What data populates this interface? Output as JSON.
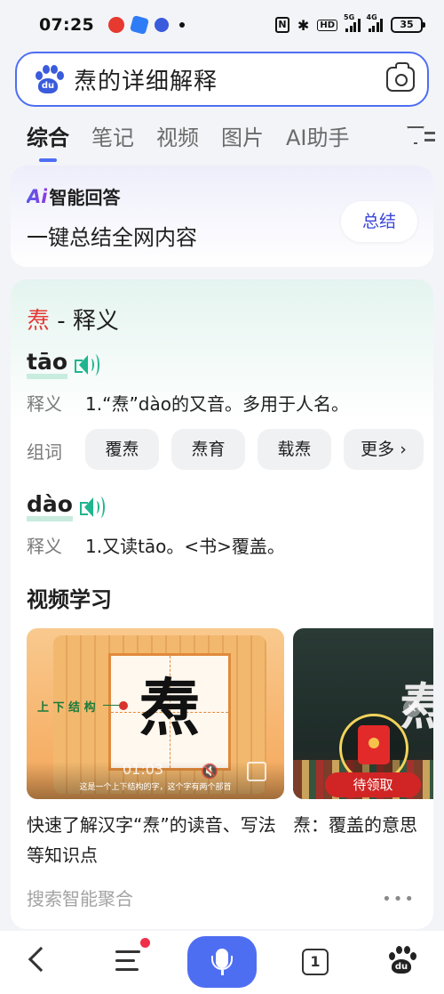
{
  "status_bar": {
    "time": "07:25",
    "hd_label": "HD",
    "signal1_label": "5G",
    "signal2_label": "4G",
    "battery": "35"
  },
  "search": {
    "query": "焘的详细解释"
  },
  "tabs": [
    {
      "label": "综合"
    },
    {
      "label": "笔记"
    },
    {
      "label": "视频"
    },
    {
      "label": "图片"
    },
    {
      "label": "AI助手"
    }
  ],
  "ai_card": {
    "mark": "Ai",
    "title": "智能回答",
    "subtitle": "一键总结全网内容",
    "button": "总结"
  },
  "definition": {
    "title_char": "焘",
    "title_rest": " - 释义",
    "readings": [
      {
        "pinyin": "tāo",
        "label": "释义",
        "meaning": "1.“焘”dào的又音。多用于人名。",
        "words_label": "组词",
        "words": [
          "覆焘",
          "焘育",
          "载焘",
          "更多 ›"
        ]
      },
      {
        "pinyin": "dào",
        "label": "释义",
        "meaning": "1.又读tāo。<书>覆盖。"
      }
    ]
  },
  "video_section": {
    "title": "视频学习",
    "videos": [
      {
        "thumb_char": "焘",
        "struct_label": "上 下 结 构",
        "duration": "01:03",
        "subtitle": "这是一个上下结构的字，这个字有两个部首",
        "caption": "快速了解汉字“焘”的读音、写法等知识点"
      },
      {
        "thumb_char": "焘",
        "badge": "待领取",
        "caption": "焘：覆盖的意思"
      }
    ]
  },
  "aggregation": {
    "label": "搜索智能聚合",
    "more": "•••"
  },
  "bottom_nav": {
    "tabs_count": "1",
    "logo_text": "du"
  },
  "icons": {
    "status": [
      "weibo-icon",
      "app-icon",
      "baidu-paw-icon",
      "nfc-icon",
      "bluetooth-icon",
      "signal-icon",
      "battery-icon"
    ],
    "search": [
      "baidu-logo-icon",
      "camera-icon"
    ],
    "accent": "#4e6ef2"
  }
}
